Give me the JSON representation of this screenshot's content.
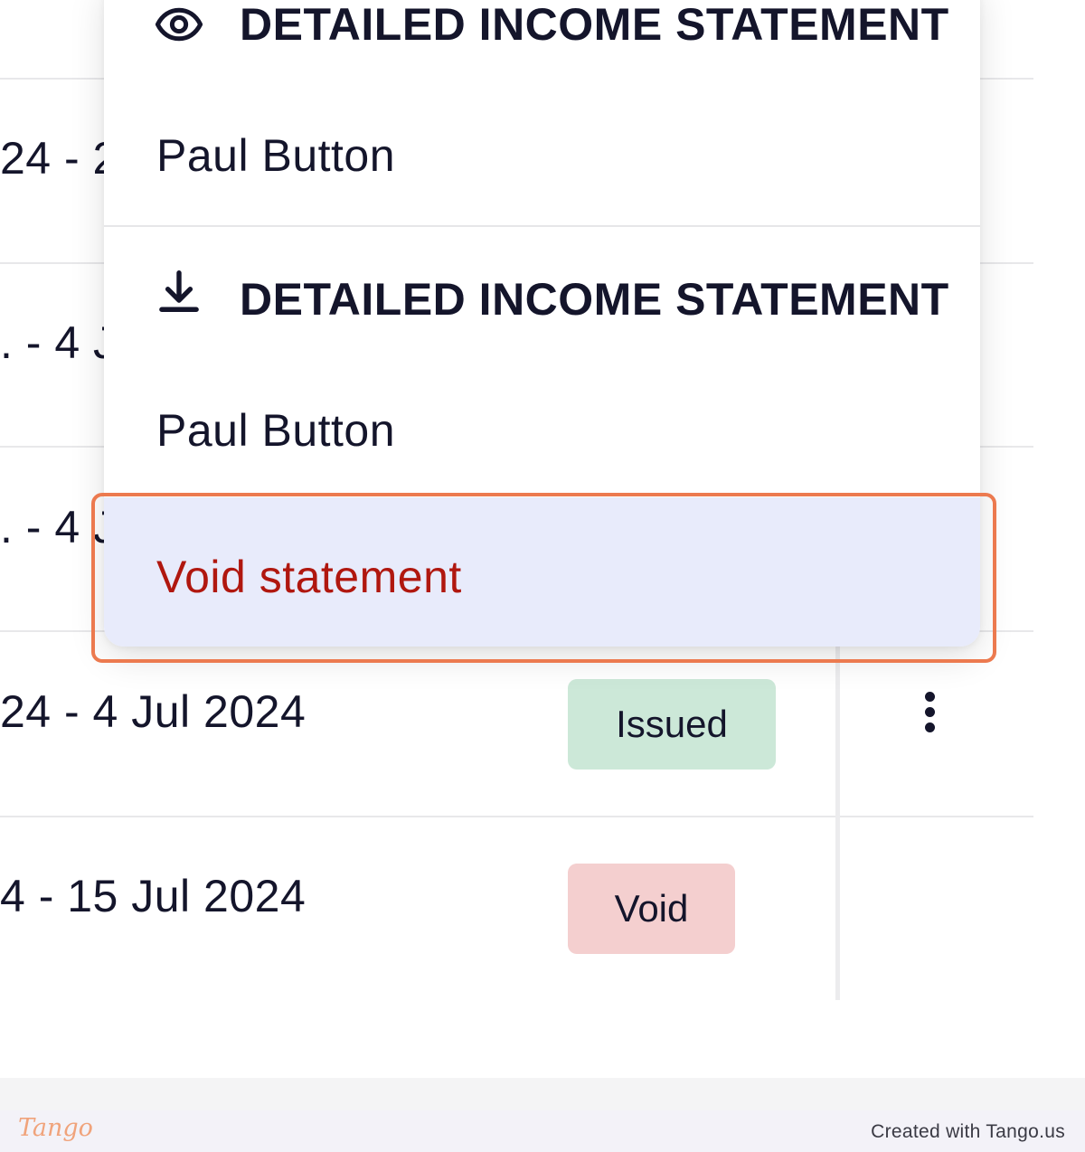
{
  "table": {
    "rows": [
      {
        "period": "24 - 2"
      },
      {
        "period": ". - 4 J"
      },
      {
        "period": ". - 4 J"
      },
      {
        "period": "24 - 4 Jul 2024",
        "status": "Issued"
      },
      {
        "period": "4 - 15 Jul 2024",
        "status": "Void"
      }
    ]
  },
  "menu": {
    "view_section": {
      "icon": "eye-icon",
      "title": "DETAILED INCOME STATEMENT",
      "person": "Paul Button"
    },
    "download_section": {
      "icon": "download-icon",
      "title": "DETAILED INCOME STATEMENT",
      "person": "Paul Button"
    },
    "void_action": "Void statement"
  },
  "status_colors": {
    "issued": "#cce8d8",
    "void": "#f4cfcf",
    "danger_text": "#b0170f",
    "highlight": "#ec7a4f"
  },
  "footer": {
    "logo": "Tango",
    "credit": "Created with Tango.us"
  }
}
